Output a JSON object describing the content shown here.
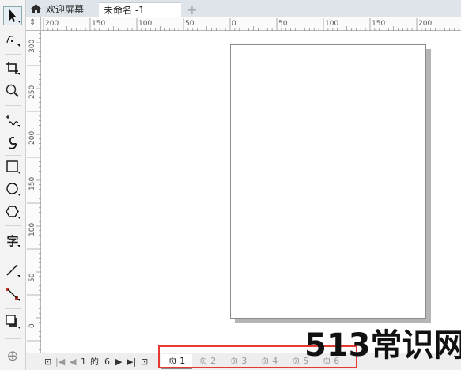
{
  "tabs": {
    "welcome_label": "欢迎屏幕",
    "document_label": "未命名 -1",
    "add_label": "+"
  },
  "toolbox": {
    "tools": [
      "pick-tool",
      "shape-tool",
      "crop-tool",
      "zoom-tool",
      "freehand-tool",
      "artistic-media-tool",
      "rectangle-tool",
      "ellipse-tool",
      "polygon-tool",
      "text-tool",
      "parallel-dimension-tool",
      "connector-tool",
      "drop-shadow-tool",
      "add-tool"
    ],
    "text_tool_label": "字",
    "add_tool_label": "⊕"
  },
  "ruler_top": {
    "labels": [
      "200",
      "150",
      "100",
      "50",
      "0",
      "50",
      "100",
      "150",
      "200"
    ],
    "unit_mark": "⇕"
  },
  "ruler_left": {
    "labels": [
      "300",
      "250",
      "200",
      "150",
      "100",
      "50",
      "0"
    ]
  },
  "page_nav": {
    "first": "⊡",
    "prev_first": "|◀",
    "prev": "◀",
    "current": "1",
    "of": "的",
    "total": "6",
    "next": "▶",
    "last": "▶|",
    "add": "⊡"
  },
  "page_tabs": [
    "页 1",
    "页 2",
    "页 3",
    "页 4",
    "页 5",
    "页 6"
  ],
  "watermark": "513常识网",
  "colors": {
    "highlight": "#e53935",
    "canvas": "#ffffff",
    "page_shadow": "#b5b5b5"
  }
}
